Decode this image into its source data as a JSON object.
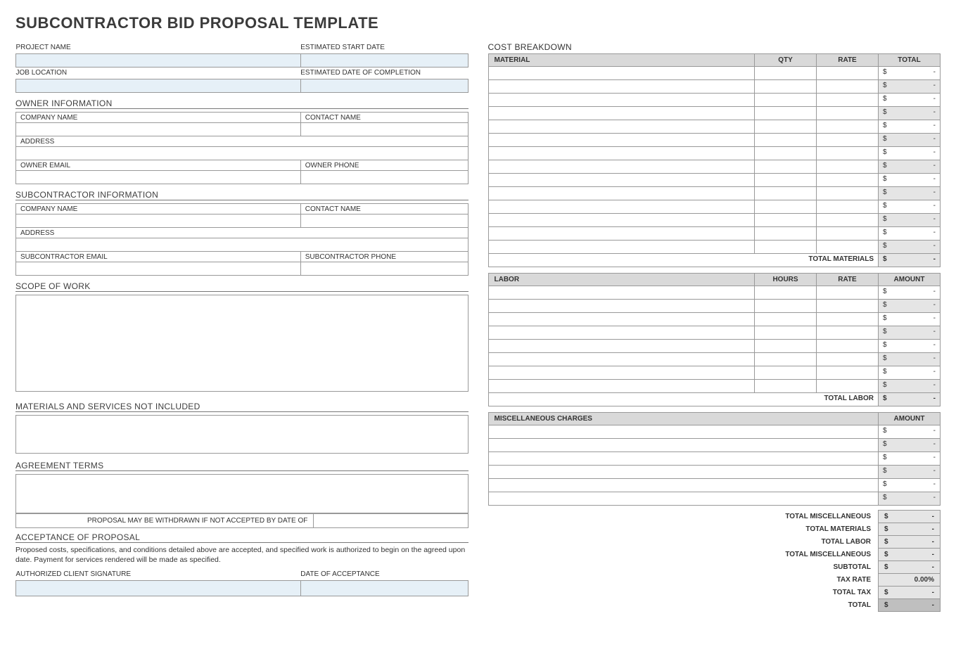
{
  "title": "SUBCONTRACTOR BID PROPOSAL TEMPLATE",
  "left": {
    "project_name_lbl": "PROJECT NAME",
    "est_start_lbl": "ESTIMATED START DATE",
    "job_location_lbl": "JOB LOCATION",
    "est_complete_lbl": "ESTIMATED DATE OF COMPLETION",
    "owner_info_lbl": "OWNER INFORMATION",
    "company_name_lbl": "COMPANY NAME",
    "contact_name_lbl": "CONTACT NAME",
    "address_lbl": "ADDRESS",
    "owner_email_lbl": "OWNER EMAIL",
    "owner_phone_lbl": "OWNER PHONE",
    "sub_info_lbl": "SUBCONTRACTOR INFORMATION",
    "sub_email_lbl": "SUBCONTRACTOR EMAIL",
    "sub_phone_lbl": "SUBCONTRACTOR PHONE",
    "scope_lbl": "SCOPE OF WORK",
    "not_included_lbl": "MATERIALS AND SERVICES NOT INCLUDED",
    "agreement_lbl": "AGREEMENT TERMS",
    "withdraw_txt": "PROPOSAL MAY BE WITHDRAWN IF NOT ACCEPTED BY DATE OF",
    "acceptance_lbl": "ACCEPTANCE OF PROPOSAL",
    "acceptance_txt": "Proposed costs, specifications, and conditions detailed above are accepted, and specified work is authorized to begin on the agreed upon date.  Payment for services rendered will be made as specified.",
    "sig_lbl": "AUTHORIZED CLIENT SIGNATURE",
    "date_accept_lbl": "DATE OF ACCEPTANCE"
  },
  "cost": {
    "breakdown_lbl": "COST BREAKDOWN",
    "material_hdr": "MATERIAL",
    "qty_hdr": "QTY",
    "rate_hdr": "RATE",
    "total_hdr": "TOTAL",
    "labor_hdr": "LABOR",
    "hours_hdr": "HOURS",
    "amount_hdr": "AMOUNT",
    "misc_hdr": "MISCELLANEOUS CHARGES",
    "currency": "$",
    "dash": "-",
    "total_materials_lbl": "TOTAL MATERIALS",
    "total_labor_lbl": "TOTAL LABOR",
    "total_misc_lbl": "TOTAL MISCELLANEOUS",
    "subtotal_lbl": "SUBTOTAL",
    "tax_rate_lbl": "TAX RATE",
    "tax_rate_val": "0.00%",
    "total_tax_lbl": "TOTAL TAX",
    "grand_total_lbl": "TOTAL",
    "material_rows": 14,
    "labor_rows": 8,
    "misc_rows": 6
  }
}
